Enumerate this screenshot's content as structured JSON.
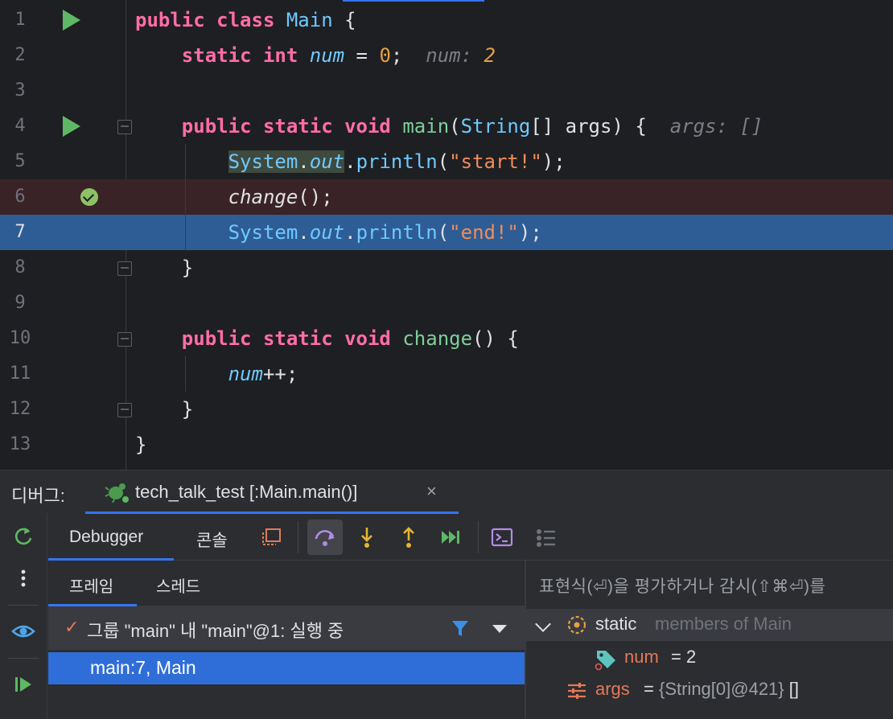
{
  "editor": {
    "hint_num_label": "num: ",
    "hint_num_value": "2",
    "hint_args": "args: []",
    "lines": [
      "1",
      "2",
      "3",
      "4",
      "5",
      "6",
      "7",
      "8",
      "9",
      "10",
      "11",
      "12",
      "13"
    ]
  },
  "debug_panel": {
    "label": "디버그:",
    "session_tab": "tech_talk_test [:Main.main()]",
    "close_glyph": "×"
  },
  "toolbar": {
    "tab_debugger": "Debugger",
    "tab_console": "콘솔"
  },
  "frames": {
    "tab_frames": "프레임",
    "tab_threads": "스레드",
    "thread_check": "✓",
    "thread_label": "그룹 \"main\" 내 \"main\"@1: 실행 중",
    "selected_frame": "main:7, Main"
  },
  "variables": {
    "eval_hint": "표현식(⏎)을 평가하거나 감시(⇧⌘⏎)를",
    "static_keyword": "static",
    "static_rest": "members of Main",
    "num_name": "num",
    "num_value": "= 2",
    "args_name": "args",
    "args_value": "{String[0]@421}",
    "args_extra": "[]"
  },
  "colors": {
    "accent": "#3574f0",
    "selection": "#2f6ed8",
    "current_line": "#2e5c94",
    "breakpoint_line": "#3a2326",
    "run_green": "#5fb865"
  }
}
